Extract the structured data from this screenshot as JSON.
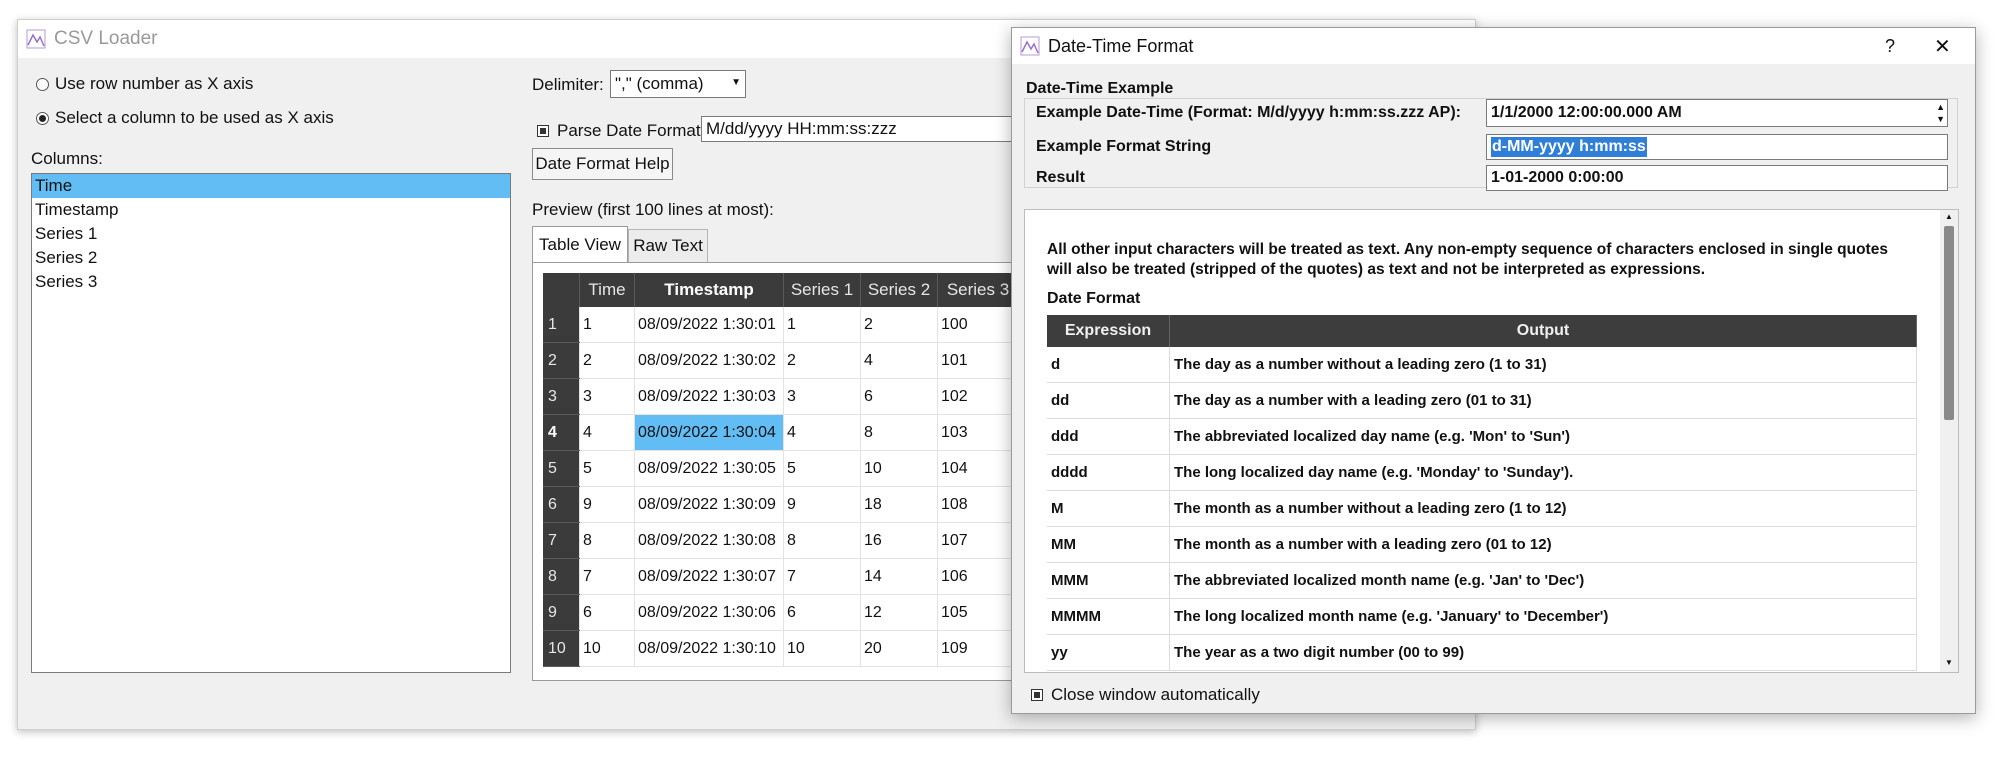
{
  "main": {
    "title": "CSV Loader",
    "radio_row_number": "Use row number as X axis",
    "radio_select_column": "Select a column to be used as X axis",
    "columns_label": "Columns:",
    "columns": [
      "Time",
      "Timestamp",
      "Series 1",
      "Series 2",
      "Series 3"
    ],
    "selected_column": "Time",
    "delimiter_label": "Delimiter:",
    "delimiter_value": "\",\" (comma)",
    "parse_date_label": "Parse Date Format",
    "parse_date_value": "M/dd/yyyy HH:mm:ss:zzz",
    "date_help_button": "Date Format Help",
    "preview_label": "Preview (first 100 lines at most):",
    "tabs": [
      "Table View",
      "Raw Text"
    ],
    "table": {
      "headers": [
        "Time",
        "Timestamp",
        "Series 1",
        "Series 2",
        "Series 3"
      ],
      "rows": [
        {
          "n": "1",
          "cells": [
            "1",
            "08/09/2022 1:30:01",
            "1",
            "2",
            "100"
          ]
        },
        {
          "n": "2",
          "cells": [
            "2",
            "08/09/2022 1:30:02",
            "2",
            "4",
            "101"
          ]
        },
        {
          "n": "3",
          "cells": [
            "3",
            "08/09/2022 1:30:03",
            "3",
            "6",
            "102"
          ]
        },
        {
          "n": "4",
          "cells": [
            "4",
            "08/09/2022 1:30:04",
            "4",
            "8",
            "103"
          ]
        },
        {
          "n": "5",
          "cells": [
            "5",
            "08/09/2022 1:30:05",
            "5",
            "10",
            "104"
          ]
        },
        {
          "n": "6",
          "cells": [
            "9",
            "08/09/2022 1:30:09",
            "9",
            "18",
            "108"
          ]
        },
        {
          "n": "7",
          "cells": [
            "8",
            "08/09/2022 1:30:08",
            "8",
            "16",
            "107"
          ]
        },
        {
          "n": "8",
          "cells": [
            "7",
            "08/09/2022 1:30:07",
            "7",
            "14",
            "106"
          ]
        },
        {
          "n": "9",
          "cells": [
            "6",
            "08/09/2022 1:30:06",
            "6",
            "12",
            "105"
          ]
        },
        {
          "n": "10",
          "cells": [
            "10",
            "08/09/2022 1:30:10",
            "10",
            "20",
            "109"
          ]
        }
      ]
    }
  },
  "dialog": {
    "title": "Date-Time Format",
    "help_button": "?",
    "close_button": "✕",
    "section_title": "Date-Time Example",
    "example_datetime_label": "Example Date-Time (Format: M/d/yyyy h:mm:ss.zzz AP):",
    "example_datetime_value": "1/1/2000 12:00:00.000 AM",
    "example_format_label": "Example Format String",
    "example_format_value": "d-MM-yyyy h:mm:ss",
    "result_label": "Result",
    "result_value": "1-01-2000 0:00:00",
    "info_text": "All other input characters will be treated as text. Any non-empty sequence of characters enclosed in single quotes will also be treated (stripped of the quotes) as text and not be interpreted as expressions.",
    "date_format_heading": "Date Format",
    "table_headers": [
      "Expression",
      "Output"
    ],
    "rows": [
      {
        "expr": "d",
        "out": "The day as a number without a leading zero (1 to 31)"
      },
      {
        "expr": "dd",
        "out": "The day as a number with a leading zero (01 to 31)"
      },
      {
        "expr": "ddd",
        "out": "The abbreviated localized day name (e.g. 'Mon' to 'Sun')"
      },
      {
        "expr": "dddd",
        "out": "The long localized day name (e.g. 'Monday' to 'Sunday')."
      },
      {
        "expr": "M",
        "out": "The month as a number without a leading zero (1 to 12)"
      },
      {
        "expr": "MM",
        "out": "The month as a number with a leading zero (01 to 12)"
      },
      {
        "expr": "MMM",
        "out": "The abbreviated localized month name (e.g. 'Jan' to 'Dec')"
      },
      {
        "expr": "MMMM",
        "out": "The long localized month name (e.g. 'January' to 'December')"
      },
      {
        "expr": "yy",
        "out": "The year as a two digit number (00 to 99)"
      }
    ],
    "close_auto_label": "Close window automatically"
  }
}
